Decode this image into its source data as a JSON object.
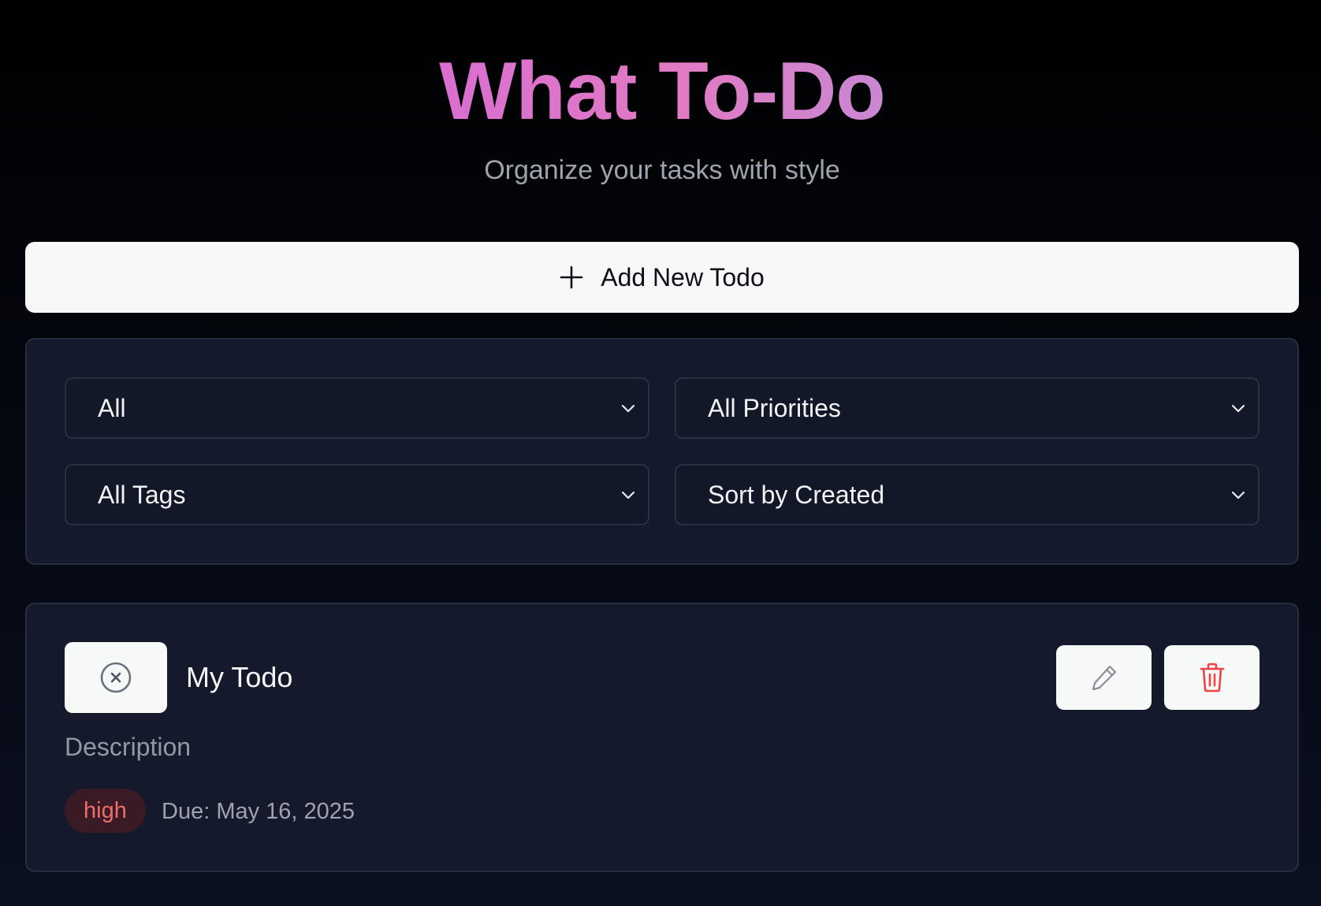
{
  "header": {
    "title": "What To-Do",
    "subtitle": "Organize your tasks with style"
  },
  "add_button": {
    "label": "Add New Todo",
    "icon": "plus-icon"
  },
  "filters": {
    "status": {
      "selected": "All"
    },
    "priority": {
      "selected": "All Priorities"
    },
    "tags": {
      "selected": "All Tags"
    },
    "sort": {
      "selected": "Sort by Created"
    },
    "icon": "chevron-down-icon"
  },
  "todos": [
    {
      "title": "My Todo",
      "description": "Description",
      "priority": "high",
      "due": "Due: May 16, 2025",
      "toggle_icon": "circle-x-icon",
      "edit_icon": "pencil-icon",
      "delete_icon": "trash-icon"
    }
  ],
  "colors": {
    "title_gradient_start": "#d96fd0",
    "title_gradient_end": "#c987d2",
    "panel_bg": "#141a2b",
    "button_bg": "#f7f8f8",
    "priority_high_text": "#f06c6c",
    "priority_high_bg": "#3a1b25"
  }
}
